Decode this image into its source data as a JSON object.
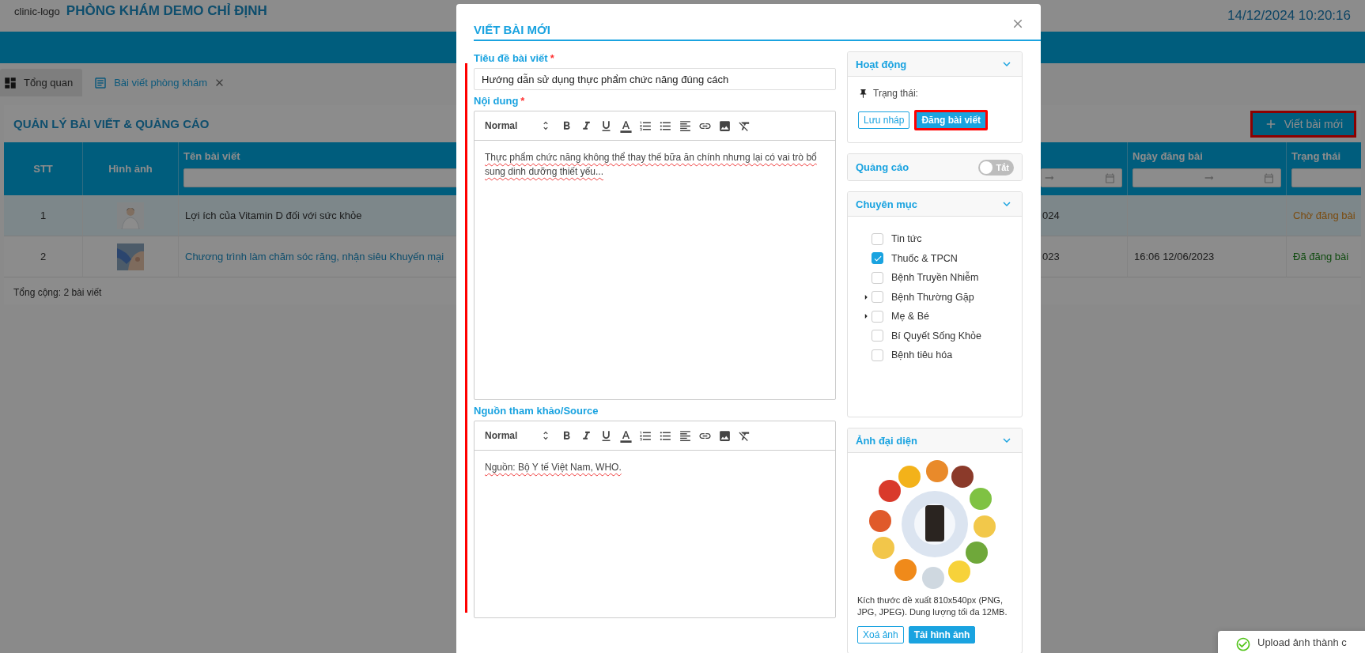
{
  "header": {
    "logo_text": "clinic-logo",
    "clinic_name": "PHÒNG KHÁM DEMO CHỈ ĐỊNH",
    "datetime": "14/12/2024 10:20:16"
  },
  "tabs": [
    {
      "label": "Tổng quan",
      "selected": false,
      "closable": false
    },
    {
      "label": "Bài viết phòng khám",
      "selected": true,
      "closable": true
    }
  ],
  "panel": {
    "title": "QUẢN LÝ BÀI VIẾT & QUẢNG CÁO",
    "new_button": {
      "label": "Viết bài mới",
      "highlighted": true
    }
  },
  "table": {
    "columns": [
      {
        "label": "STT"
      },
      {
        "label": "Hình ảnh"
      },
      {
        "label": "Tên bài viết"
      },
      {},
      {
        "label": "Ngày đăng bài"
      },
      {
        "label": "Trạng thái"
      }
    ],
    "rows": [
      {
        "stt": "1",
        "title": "Lợi ích của Vitamin D đối với sức khỏe",
        "title_link": false,
        "column_4": "024",
        "status": {
          "text": "Chờ đăng bài",
          "kind": "pending"
        },
        "selected": true
      },
      {
        "stt": "2",
        "title": "Chương trình làm chăm sóc răng, nhận siêu Khuyến mại",
        "title_link": true,
        "column_4": "023",
        "posted": "16:06 12/06/2023",
        "status": {
          "text": "Đã đăng bài",
          "kind": "published"
        },
        "selected": false
      }
    ],
    "footer": "Tổng cộng: 2 bài viết"
  },
  "modal": {
    "title": "VIẾT BÀI MỚI",
    "fields": [
      {
        "kind": "input",
        "label": "Tiêu đề bài viết",
        "required_mark": "*",
        "value": "Hướng dẫn sử dụng thực phẩm chức năng đúng cách"
      },
      {
        "kind": "editor",
        "label": "Nội dung",
        "required_mark": "*",
        "format": "Normal",
        "text": "Thực phẩm chức năng không thể thay thế bữa ăn chính nhưng lại có vai trò bổ sung dinh dưỡng thiết yếu..."
      },
      {
        "kind": "editor",
        "label": "Nguồn tham khảo/Source",
        "format": "Normal",
        "text": "Nguồn: Bộ Y tế Việt Nam, WHO."
      }
    ],
    "activity": {
      "title": "Hoạt động",
      "status_label": "Trạng thái:",
      "buttons": [
        {
          "label": "Lưu nháp",
          "kind": "outline",
          "highlighted": false
        },
        {
          "label": "Đăng bài viết",
          "kind": "primary",
          "highlighted": true
        }
      ]
    },
    "ads": {
      "title": "Quảng cáo",
      "toggle": {
        "on": false,
        "label": "Tắt"
      }
    },
    "categories": {
      "title": "Chuyên mục",
      "items": [
        {
          "label": "Tin tức",
          "checked": false,
          "expandable": false
        },
        {
          "label": "Thuốc & TPCN",
          "checked": true,
          "expandable": false
        },
        {
          "label": "Bệnh Truyền Nhiễm",
          "checked": false,
          "expandable": false
        },
        {
          "label": "Bệnh Thường Gặp",
          "checked": false,
          "expandable": true
        },
        {
          "label": "Mẹ & Bé",
          "checked": false,
          "expandable": true
        },
        {
          "label": "Bí Quyết Sống Khỏe",
          "checked": false,
          "expandable": false
        },
        {
          "label": "Bệnh tiêu hóa",
          "checked": false,
          "expandable": false
        }
      ]
    },
    "cover": {
      "title": "Ảnh đại diện",
      "hint": "Kích thước đề xuất 810x540px (PNG, JPG, JPEG). Dung lượng tối đa 12MB.",
      "buttons": [
        {
          "label": "Xoá ảnh",
          "kind": "outline",
          "highlighted": false
        },
        {
          "label": "Tải hình ảnh",
          "kind": "primary",
          "highlighted": false
        }
      ]
    }
  },
  "toast": {
    "kind": "success",
    "text": "Upload ảnh thành c"
  }
}
